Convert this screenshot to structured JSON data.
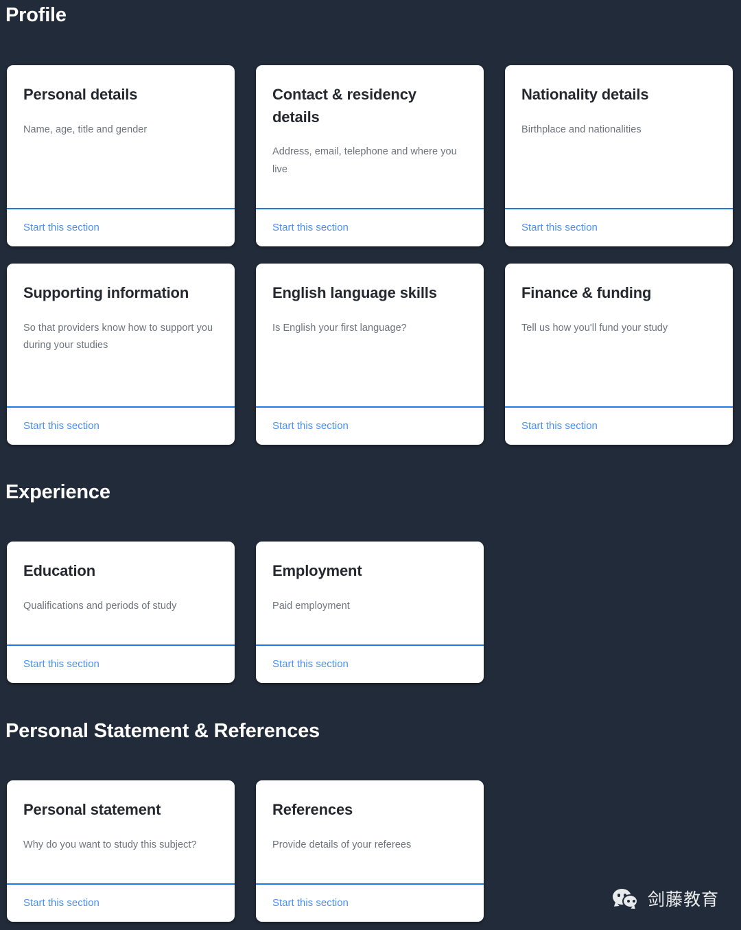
{
  "theme": {
    "background": "#222b39",
    "card_background": "#ffffff",
    "accent_blue": "#1f78e5",
    "link_blue": "#4a8ff0",
    "heading_color": "#ffffff",
    "title_color": "#25292f",
    "description_color": "#6d737c"
  },
  "sections": [
    {
      "id": "profile",
      "heading": "Profile",
      "rows": [
        {
          "id": "profile-row-1",
          "cards": [
            {
              "title": "Personal details",
              "description": "Name, age, title and gender",
              "link_label": "Start this section"
            },
            {
              "title": "Contact & residency details",
              "description": "Address, email, telephone and where you live",
              "link_label": "Start this section"
            },
            {
              "title": "Nationality details",
              "description": "Birthplace and nationalities",
              "link_label": "Start this section"
            }
          ]
        },
        {
          "id": "profile-row-2",
          "cards": [
            {
              "title": "Supporting information",
              "description": "So that providers know how to support you during your studies",
              "link_label": "Start this section"
            },
            {
              "title": "English language skills",
              "description": "Is English your first language?",
              "link_label": "Start this section"
            },
            {
              "title": "Finance & funding",
              "description": "Tell us how you'll fund your study",
              "link_label": "Start this section"
            }
          ]
        }
      ]
    },
    {
      "id": "experience",
      "heading": "Experience",
      "rows": [
        {
          "id": "experience-row-1",
          "cards": [
            {
              "title": "Education",
              "description": "Qualifications and periods of study",
              "link_label": "Start this section"
            },
            {
              "title": "Employment",
              "description": "Paid employment",
              "link_label": "Start this section"
            }
          ]
        }
      ]
    },
    {
      "id": "statement",
      "heading": "Personal Statement & References",
      "rows": [
        {
          "id": "statement-row-1",
          "cards": [
            {
              "title": "Personal statement",
              "description": "Why do you want to study this subject?",
              "link_label": "Start this section"
            },
            {
              "title": "References",
              "description": "Provide details of your referees",
              "link_label": "Start this section"
            }
          ]
        }
      ]
    }
  ],
  "watermark": {
    "icon": "wechat-icon",
    "text": "剑藤教育"
  }
}
